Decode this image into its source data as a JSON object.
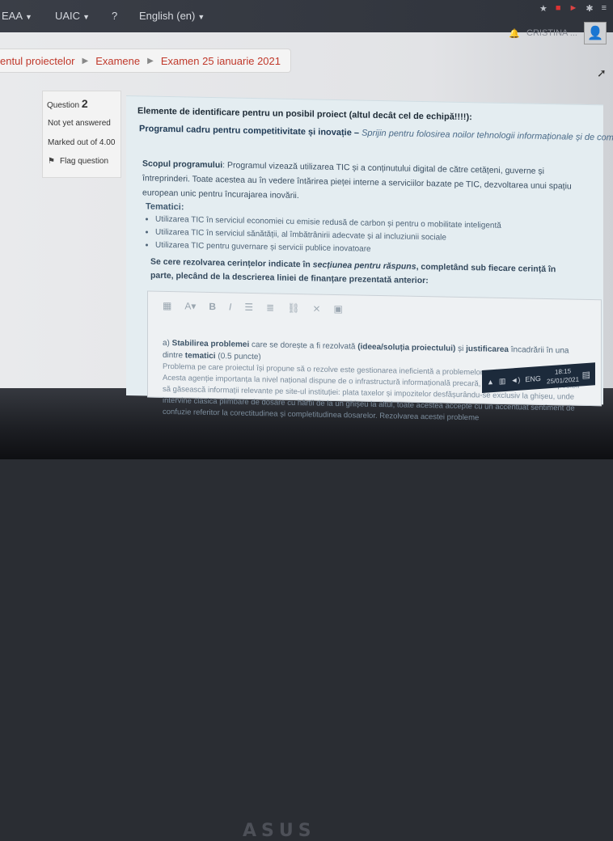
{
  "topnav": {
    "items": [
      "EAA",
      "UAIC",
      "?",
      "English (en)"
    ],
    "user_name": "CRISTINA ..."
  },
  "breadcrumb": [
    "entul proiectelor",
    "Examene",
    "Examen 25 ianuarie 2021"
  ],
  "question_info": {
    "label": "Question",
    "number": "2",
    "status": "Not yet answered",
    "marks": "Marked out of 4.00",
    "flag": "Flag question"
  },
  "question": {
    "title": "Elemente de identificare pentru un posibil proiect (altul decât cel de echipă!!!!):",
    "program_bold": "Programul cadru pentru competitivitate și inovație –",
    "program_italic": " Sprijin pentru folosirea noilor tehnologii informaționale și de comunicații (TIC)",
    "scope_label": "Scopul programului",
    "scope_text": ": Programul vizează utilizarea TIC și a conținutului digital de către cetățeni, guverne și întreprinderi. Toate acestea au în vedere întărirea pieței interne a serviciilor bazate pe TIC, dezvoltarea unui spațiu european unic pentru încurajarea inovării.",
    "themes_label": "Tematici",
    "themes": [
      "Utilizarea TIC în serviciul economiei cu emisie redusă de carbon și pentru o mobilitate inteligentă",
      "Utilizarea TIC în serviciul sănătății, al îmbătrânirii adecvate și al incluziunii sociale",
      "Utilizarea TIC pentru guvernare și servicii publice inovatoare"
    ],
    "req_a": "Se cere rezolvarea cerințelor indicate în ",
    "req_b": "secțiunea pentru răspuns",
    "req_c": ", completând sub fiecare cerință în parte, plecând de la descrierea liniei de finanțare prezentată anterior:"
  },
  "editor": {
    "toolbar_icons": [
      "paragraph-style-icon",
      "text-style-icon",
      "bold-icon",
      "italic-icon",
      "bullet-list-icon",
      "numbered-list-icon",
      "link-icon",
      "unlink-icon",
      "image-icon"
    ],
    "answer_a_prefix": "a) ",
    "answer_a_bold": "Stabilirea problemei",
    "answer_a_mid": " care se dorește a fi rezolvată ",
    "answer_a_bold2": "(ideea/soluția proiectului)",
    "answer_a_mid2": " și ",
    "answer_a_bold3": "justificarea",
    "answer_a_end": " încadrării în una dintre ",
    "answer_a_bold4": "tematici",
    "answer_a_points": " (0.5 puncte)",
    "answer_body": "Problema pe care proiectul își propune să o rezolve este gestionarea ineficientă a problemelor cetățenilor în instituția ANAF. Acesta agenție importanța la nivel național dispune de o infrastructură informațională precară, cetățenilor fiindu-le imposibil să găsească informații relevante pe site-ul instituției: plata taxelor și impozitelor desfășurându-se exclusiv la ghișeu, unde intervine clasica plimbare de dosare cu hârtii de la un ghișeu la altul, toate acestea accepte cu un accentuat sentiment de confuzie referitor la corectitudinea și completitudinea dosarelor. Rezolvarea acestei probleme"
  },
  "taskbar": {
    "lang": "ENG",
    "time": "18:15",
    "date": "25/01/2021"
  },
  "bezel_logo": "ASUS"
}
